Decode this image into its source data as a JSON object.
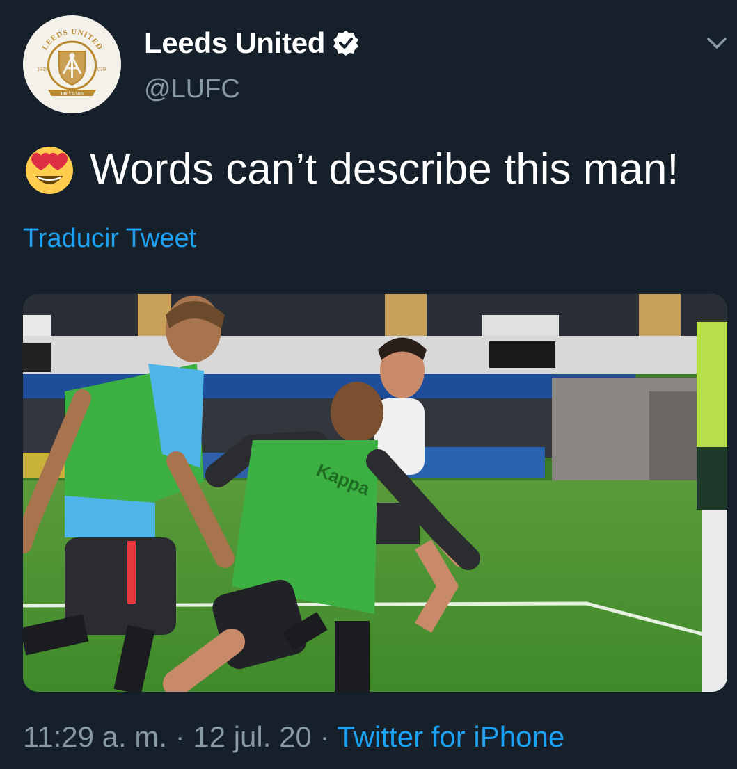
{
  "tweet": {
    "display_name": "Leeds United",
    "handle": "@LUFC",
    "verified": true,
    "text": "Words can’t describe this man!",
    "emoji": "smiling-face-with-heart-eyes",
    "translate_label": "Traducir Tweet",
    "time": "11:29 a. m.",
    "separator": " · ",
    "date": "12 jul. 20",
    "source": "Twitter for iPhone"
  },
  "avatar": {
    "arc_text": "LEEDS UNITED",
    "left_year": "1919",
    "right_year": "2019",
    "ribbon_text": "100 YEARS"
  },
  "photo": {
    "bib_text": "Kappa"
  },
  "colors": {
    "background": "#15202b",
    "link": "#1da1f2",
    "secondary_text": "#8899a6",
    "primary_text": "#ffffff"
  }
}
